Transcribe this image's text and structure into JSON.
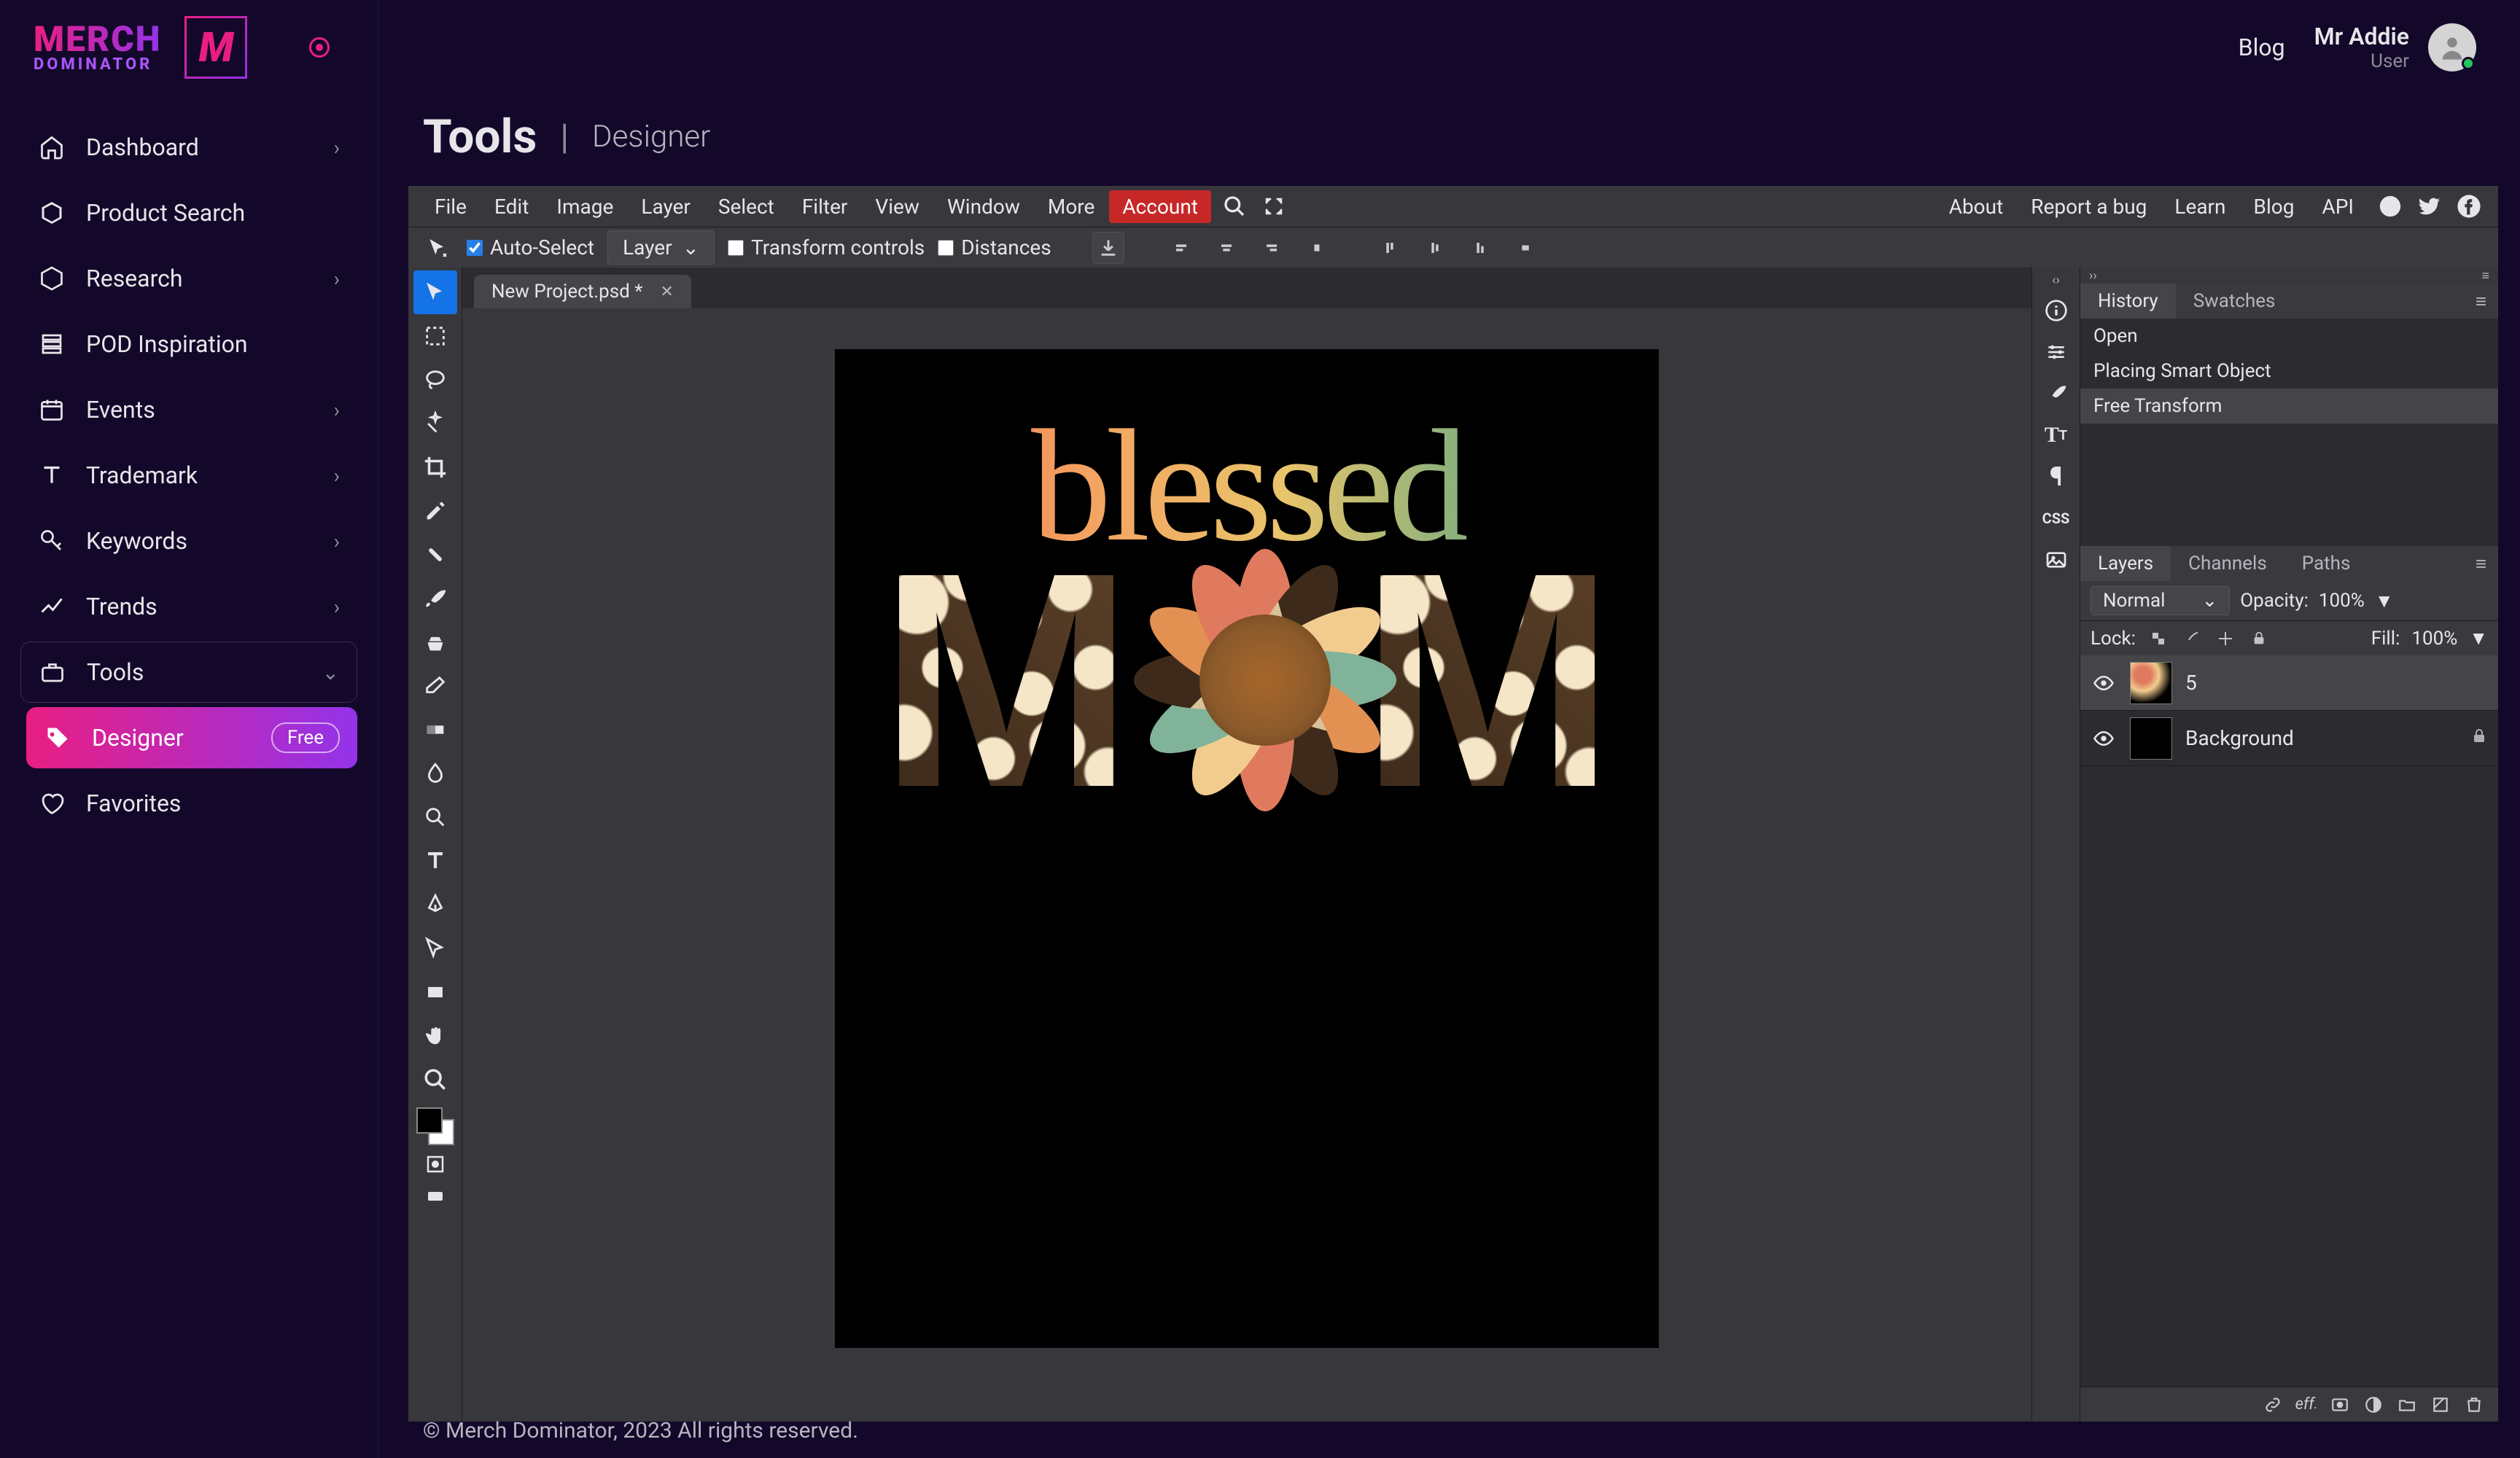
{
  "brand": {
    "line1": "MERCH",
    "line2": "DOMINATOR",
    "mark": "M"
  },
  "sidebar": {
    "items": [
      {
        "label": "Dashboard",
        "icon": "home",
        "chev": true
      },
      {
        "label": "Product Search",
        "icon": "cube"
      },
      {
        "label": "Research",
        "icon": "cube2",
        "chev": true
      },
      {
        "label": "POD Inspiration",
        "icon": "layers"
      },
      {
        "label": "Events",
        "icon": "calendar",
        "chev": true
      },
      {
        "label": "Trademark",
        "icon": "text",
        "chev": true
      },
      {
        "label": "Keywords",
        "icon": "key",
        "chev": true
      },
      {
        "label": "Trends",
        "icon": "trend",
        "chev": true
      },
      {
        "label": "Tools",
        "icon": "briefcase",
        "chev": true,
        "boxed": true
      },
      {
        "label": "Favorites",
        "icon": "heart"
      }
    ],
    "designer": {
      "label": "Designer",
      "badge": "Free"
    }
  },
  "topbar": {
    "blog": "Blog",
    "user_name": "Mr Addie",
    "user_role": "User"
  },
  "crumb": {
    "title": "Tools",
    "sub": "Designer"
  },
  "menus": [
    "File",
    "Edit",
    "Image",
    "Layer",
    "Select",
    "Filter",
    "View",
    "Window",
    "More",
    "Account"
  ],
  "menu_right": [
    "About",
    "Report a bug",
    "Learn",
    "Blog",
    "API"
  ],
  "optbar": {
    "auto_select": "Auto-Select",
    "layer": "Layer",
    "transform": "Transform controls",
    "distances": "Distances"
  },
  "tab": {
    "name": "New Project.psd *"
  },
  "art": {
    "blessed": "blessed",
    "m1": "M",
    "m2": "M"
  },
  "history": {
    "tabs": [
      "History",
      "Swatches"
    ],
    "items": [
      "Open",
      "Placing Smart Object",
      "Free Transform"
    ]
  },
  "layers": {
    "tabs": [
      "Layers",
      "Channels",
      "Paths"
    ],
    "blend": "Normal",
    "opacity_label": "Opacity:",
    "opacity": "100%",
    "lock_label": "Lock:",
    "fill_label": "Fill:",
    "fill": "100%",
    "rows": [
      {
        "name": "5"
      },
      {
        "name": "Background",
        "locked": true
      }
    ]
  },
  "footer": "© Merch Dominator, 2023 All rights reserved."
}
